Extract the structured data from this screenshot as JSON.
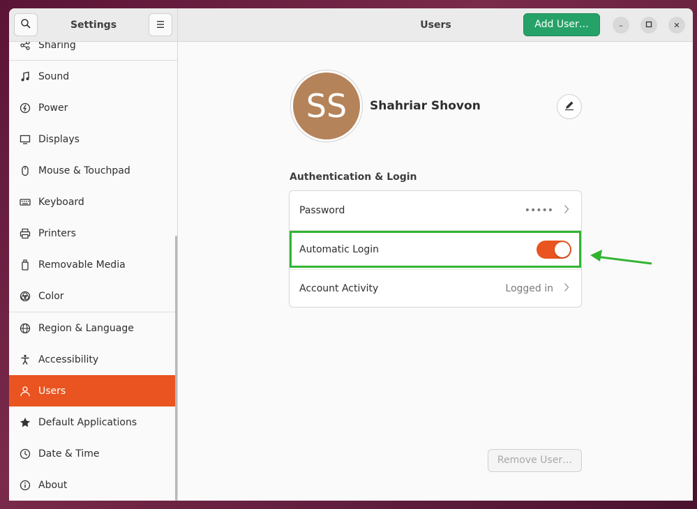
{
  "header": {
    "sidebar_title": "Settings",
    "page_title": "Users",
    "add_user_label": "Add User…"
  },
  "sidebar": {
    "items": [
      {
        "label": "Sharing",
        "icon": "share-icon"
      },
      {
        "label": "Sound",
        "icon": "music-note-icon"
      },
      {
        "label": "Power",
        "icon": "power-icon"
      },
      {
        "label": "Displays",
        "icon": "display-icon"
      },
      {
        "label": "Mouse & Touchpad",
        "icon": "mouse-icon"
      },
      {
        "label": "Keyboard",
        "icon": "keyboard-icon"
      },
      {
        "label": "Printers",
        "icon": "printer-icon"
      },
      {
        "label": "Removable Media",
        "icon": "usb-drive-icon"
      },
      {
        "label": "Color",
        "icon": "color-icon"
      },
      {
        "label": "Region & Language",
        "icon": "globe-icon"
      },
      {
        "label": "Accessibility",
        "icon": "accessibility-icon"
      },
      {
        "label": "Users",
        "icon": "users-icon",
        "active": true
      },
      {
        "label": "Default Applications",
        "icon": "star-icon"
      },
      {
        "label": "Date & Time",
        "icon": "clock-icon"
      },
      {
        "label": "About",
        "icon": "info-icon"
      }
    ]
  },
  "user": {
    "initials": "SS",
    "name": "Shahriar Shovon",
    "avatar_color": "#b5835a"
  },
  "auth": {
    "section_title": "Authentication & Login",
    "rows": [
      {
        "label": "Password",
        "value": "•••••"
      },
      {
        "label": "Automatic Login",
        "toggle": true
      },
      {
        "label": "Account Activity",
        "value": "Logged in"
      }
    ]
  },
  "remove_user_label": "Remove User…",
  "colors": {
    "accent": "#e95420",
    "add_button": "#26a269",
    "highlight": "#32b432"
  }
}
